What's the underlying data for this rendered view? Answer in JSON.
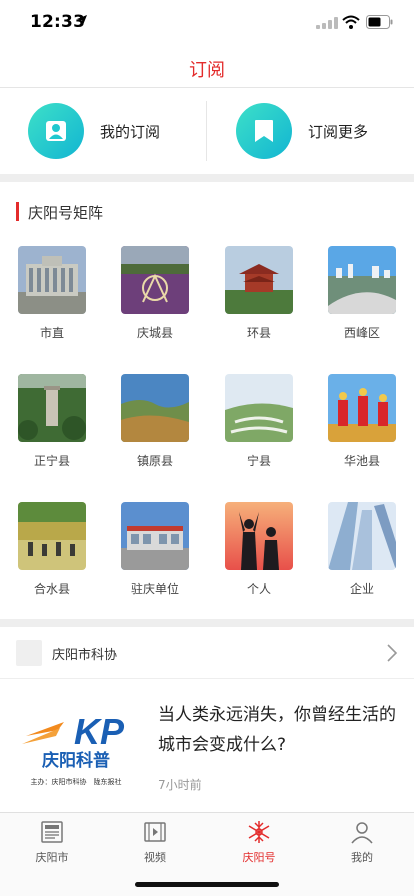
{
  "status": {
    "time": "12:33"
  },
  "nav": {
    "title": "订阅"
  },
  "subscriptions": {
    "my_label": "我的订阅",
    "more_label": "订阅更多"
  },
  "matrix": {
    "title": "庆阳号矩阵",
    "items": [
      {
        "label": "市直"
      },
      {
        "label": "庆城县"
      },
      {
        "label": "环县"
      },
      {
        "label": "西峰区"
      },
      {
        "label": "正宁县"
      },
      {
        "label": "镇原县"
      },
      {
        "label": "宁县"
      },
      {
        "label": "华池县"
      },
      {
        "label": "合水县"
      },
      {
        "label": "驻庆单位"
      },
      {
        "label": "个人"
      },
      {
        "label": "企业"
      }
    ]
  },
  "feed": {
    "source_name": "庆阳市科协",
    "article": {
      "title": "当人类永远消失，你曾经生活的城市会变成什么?",
      "time": "7小时前",
      "logo_text": "KP",
      "logo_caption": "庆阳科普",
      "logo_sub": "主办：庆阳市科协　陇东报社"
    }
  },
  "tabs": [
    {
      "label": "庆阳市",
      "active": false
    },
    {
      "label": "视频",
      "active": false
    },
    {
      "label": "庆阳号",
      "active": true
    },
    {
      "label": "我的",
      "active": false
    }
  ],
  "colors": {
    "accent": "#e32b2b",
    "teal": "#1fc8cf"
  }
}
